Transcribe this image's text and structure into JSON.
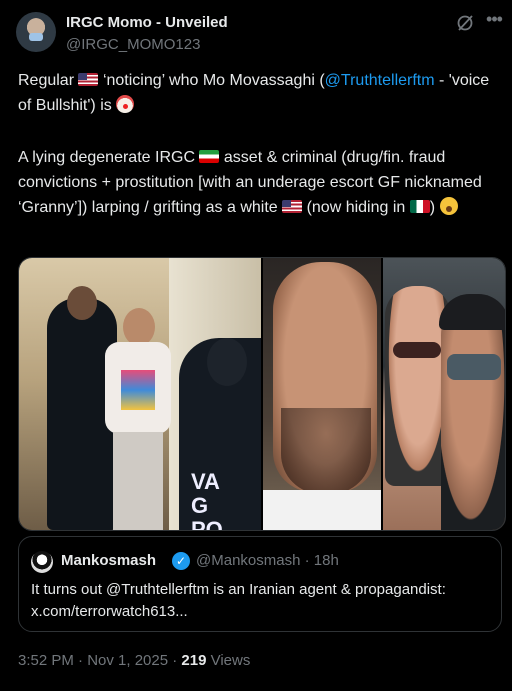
{
  "author": {
    "name": "IRGC Momo - Unveiled",
    "handle": "@IRGC_MOMO123"
  },
  "icons": {
    "grok": "grok-icon",
    "more": "more-icon"
  },
  "tweet": {
    "p1_a": "Regular",
    "p1_b": "‘noticing’ who Mo Movassaghi (",
    "p1_link": "@Truthtellerftm",
    "p1_c": " - 'voice of Bullshit') is",
    "p2_a": "A lying degenerate IRGC",
    "p2_b": "asset & criminal (drug/fin. fraud convictions + prostitution [with an underage escort GF nicknamed ‘Granny’]) larping / grifting as a white",
    "p2_c": "(now hiding in",
    "p2_d": ")"
  },
  "media": {
    "image1_text": "VA\nG\nPO"
  },
  "quote": {
    "name": "Mankosmash",
    "verified_mark": "✓",
    "handle_time": "@Mankosmash · 18h",
    "text_line1": "It turns out @Truthtellerftm is an Iranian agent & propagandist:",
    "text_line2": "x.com/terrorwatch613..."
  },
  "meta": {
    "time": "3:52 PM · Nov 1, 2025 · ",
    "views_count": "219",
    "views_label": " Views"
  },
  "colors": {
    "background": "#000000",
    "text": "#e7e9ea",
    "muted": "#71767b",
    "link": "#1d9bf0",
    "border": "#2f3336"
  }
}
